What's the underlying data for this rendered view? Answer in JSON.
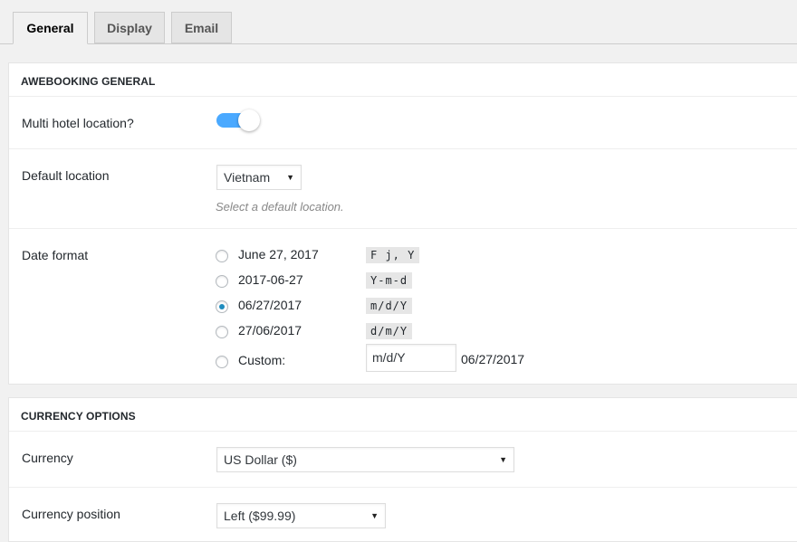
{
  "tabs": [
    {
      "label": "General",
      "active": true
    },
    {
      "label": "Display",
      "active": false
    },
    {
      "label": "Email",
      "active": false
    }
  ],
  "general_section": {
    "title": "AWEBOOKING GENERAL",
    "multi_hotel": {
      "label": "Multi hotel location?",
      "enabled": true
    },
    "default_location": {
      "label": "Default location",
      "value": "Vietnam",
      "description": "Select a default location."
    },
    "date_format": {
      "label": "Date format",
      "options": [
        {
          "label": "June 27, 2017",
          "code": "F j, Y",
          "checked": false
        },
        {
          "label": "2017-06-27",
          "code": "Y-m-d",
          "checked": false
        },
        {
          "label": "06/27/2017",
          "code": "m/d/Y",
          "checked": true
        },
        {
          "label": "27/06/2017",
          "code": "d/m/Y",
          "checked": false
        }
      ],
      "custom": {
        "label": "Custom:",
        "value": "m/d/Y",
        "preview": "06/27/2017",
        "checked": false
      }
    }
  },
  "currency_section": {
    "title": "CURRENCY OPTIONS",
    "currency": {
      "label": "Currency",
      "value": "US Dollar ($)"
    },
    "currency_position": {
      "label": "Currency position",
      "value": "Left ($99.99)"
    }
  },
  "colors": {
    "accent": "#4aa9ff",
    "radio_checked": "#1e8cbe"
  }
}
